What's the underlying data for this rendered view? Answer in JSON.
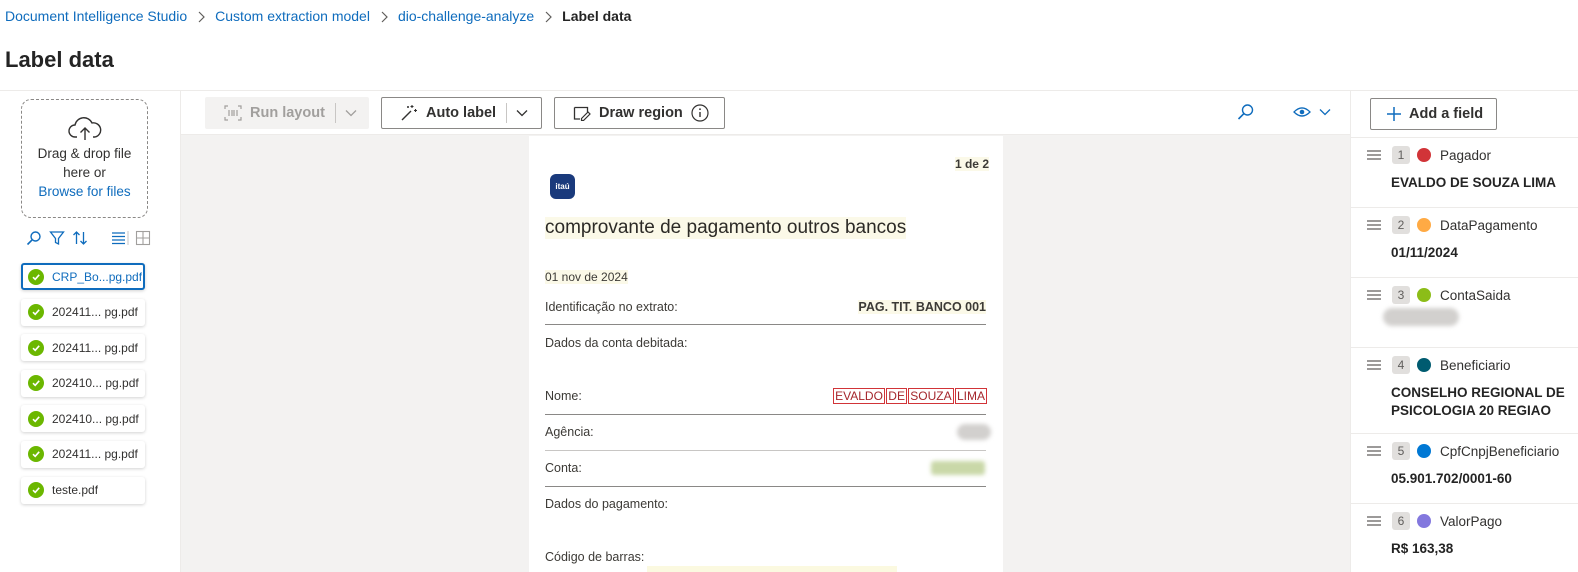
{
  "breadcrumb": {
    "items": [
      "Document Intelligence Studio",
      "Custom extraction model",
      "dio-challenge-analyze"
    ],
    "current": "Label data"
  },
  "page_title": "Label data",
  "upload": {
    "text": "Drag & drop file here or",
    "link": "Browse for files"
  },
  "files": [
    {
      "name": "CRP_Bo...pg.pdf",
      "status": "labeled"
    },
    {
      "name": "202411... pg.pdf",
      "status": "labeled"
    },
    {
      "name": "202411... pg.pdf",
      "status": "labeled"
    },
    {
      "name": "202410... pg.pdf",
      "status": "labeled"
    },
    {
      "name": "202410... pg.pdf",
      "status": "labeled"
    },
    {
      "name": "202411... pg.pdf",
      "status": "labeled"
    },
    {
      "name": "teste.pdf",
      "status": "labeled"
    }
  ],
  "toolbar": {
    "run_layout": "Run layout",
    "auto_label": "Auto label",
    "draw_region": "Draw region"
  },
  "document": {
    "page_indicator": "1 de 2",
    "logo_text": "itaú",
    "title": "comprovante de pagamento outros bancos",
    "date": "01 nov de 2024",
    "id_label": "Identificação no extrato:",
    "id_value": "PAG. TIT. BANCO 001",
    "section_account": "Dados da conta debitada:",
    "name_label": "Nome:",
    "name_words": [
      "EVALDO",
      "DE",
      "SOUZA",
      "LIMA"
    ],
    "agency_label": "Agência:",
    "account_label": "Conta:",
    "section_payment": "Dados do pagamento:",
    "barcode_label": "Código de barras:"
  },
  "fields_panel": {
    "add_label": "Add a field",
    "fields": [
      {
        "index": "1",
        "name": "Pagador",
        "color": "#d13438",
        "value": "EVALDO DE SOUZA LIMA"
      },
      {
        "index": "2",
        "name": "DataPagamento",
        "color": "#ffaa44",
        "value": "01/11/2024"
      },
      {
        "index": "3",
        "name": "ContaSaida",
        "color": "#8cbd18",
        "value": ""
      },
      {
        "index": "4",
        "name": "Beneficiario",
        "color": "#005b70",
        "value": "CONSELHO REGIONAL DE PSICOLOGIA 20 REGIAO"
      },
      {
        "index": "5",
        "name": "CpfCnpjBeneficiario",
        "color": "#0078d4",
        "value": "05.901.702/0001-60"
      },
      {
        "index": "6",
        "name": "ValorPago",
        "color": "#8378de",
        "value": "R$ 163,38"
      }
    ]
  }
}
